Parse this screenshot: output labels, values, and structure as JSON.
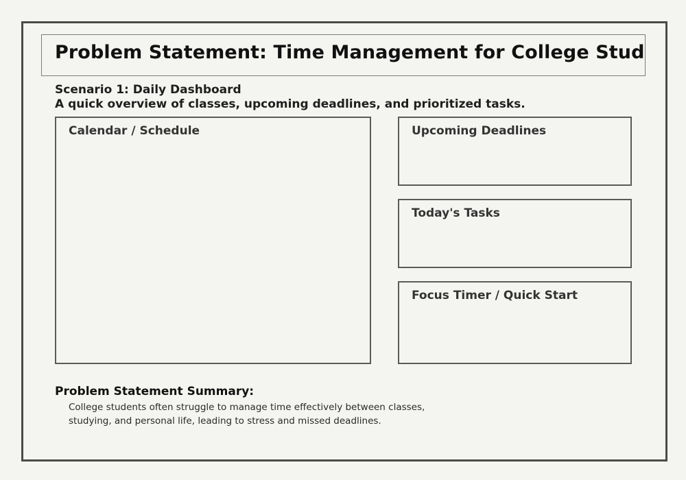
{
  "header": {
    "title": "Problem Statement: Time Management for College Students"
  },
  "scenario": {
    "title": "Scenario 1: Daily Dashboard",
    "description": "A quick overview of classes, upcoming deadlines, and prioritized tasks."
  },
  "panels": {
    "calendar": {
      "label": "Calendar / Schedule"
    },
    "deadlines": {
      "label": "Upcoming Deadlines"
    },
    "tasks": {
      "label": "Today's Tasks"
    },
    "focus": {
      "label": "Focus Timer / Quick Start"
    }
  },
  "summary": {
    "heading": "Problem Statement Summary:",
    "lines": [
      "College students often struggle to manage time effectively between classes,",
      "studying, and personal life, leading to stress and missed deadlines."
    ]
  },
  "colors": {
    "background": "#f4f5f0",
    "frame_border": "#4a4a48",
    "panel_border": "#5a5a58",
    "title_text": "#111111"
  }
}
